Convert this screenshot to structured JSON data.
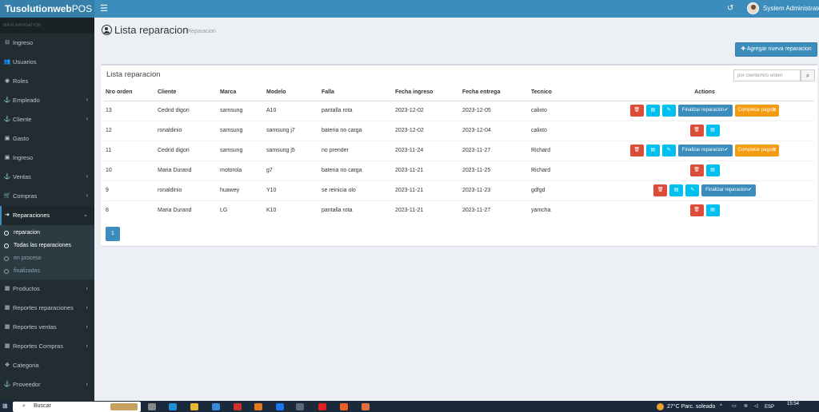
{
  "app": {
    "brand_bold": "Tusolutionweb",
    "brand_light": "POS",
    "user_name": "System Administrator"
  },
  "sidebar": {
    "header": "MAIN NAVIGATION",
    "items_top": [
      {
        "label": "Ingreso",
        "icon": "sign-in-icon",
        "glyph": "⊟",
        "chevron": false
      },
      {
        "label": "Usuarios",
        "icon": "users-icon",
        "glyph": "👥",
        "chevron": false
      },
      {
        "label": "Roles",
        "icon": "user-circle-icon",
        "glyph": "◉",
        "chevron": false
      },
      {
        "label": "Empleado",
        "icon": "anchor-icon",
        "glyph": "⚓",
        "chevron": true
      },
      {
        "label": "Cliente",
        "icon": "anchor-icon",
        "glyph": "⚓",
        "chevron": true
      },
      {
        "label": "Gasto",
        "icon": "money-icon",
        "glyph": "▣",
        "chevron": false
      },
      {
        "label": "Ingreso",
        "icon": "sign-in-icon",
        "glyph": "▣",
        "chevron": false
      },
      {
        "label": "Ventas",
        "icon": "anchor-icon",
        "glyph": "⚓",
        "chevron": true
      },
      {
        "label": "Compras",
        "icon": "cart-icon",
        "glyph": "🛒",
        "chevron": true
      }
    ],
    "active_item": {
      "label": "Reparaciones",
      "icon": "sign-in-icon",
      "glyph": "➔"
    },
    "subitems": [
      {
        "label": "reparacion",
        "on": true
      },
      {
        "label": "Todas las reparaciones",
        "on": true
      },
      {
        "label": "en proceso",
        "on": false
      },
      {
        "label": "finalizadas",
        "on": false
      }
    ],
    "items_bottom": [
      {
        "label": "Productos",
        "icon": "shop-icon",
        "glyph": "▦",
        "chevron": true
      },
      {
        "label": "Reportes reparaciones",
        "icon": "calendar-icon",
        "glyph": "▦",
        "chevron": true
      },
      {
        "label": "Reportes ventas",
        "icon": "calendar-icon",
        "glyph": "▦",
        "chevron": true
      },
      {
        "label": "Reportes Compras",
        "icon": "calendar-icon",
        "glyph": "▦",
        "chevron": true
      },
      {
        "label": "Categoria",
        "icon": "arrows-icon",
        "glyph": "✥",
        "chevron": false
      },
      {
        "label": "Proveedor",
        "icon": "anchor-icon",
        "glyph": "⚓",
        "chevron": true
      }
    ]
  },
  "page": {
    "title": "Lista reparacion",
    "subtitle": "Reparacion",
    "add_button": "✚ Agregar nueva reparacion"
  },
  "table": {
    "box_title": "Lista reparacion",
    "search_placeholder": "por cliente/Nro orden",
    "columns": [
      "Nro orden",
      "Cliente",
      "Marca",
      "Modelo",
      "Falla",
      "Fecha ingreso",
      "Fecha entrega",
      "Tecnico",
      "Actions"
    ],
    "action_labels": {
      "finalize": "Finalizar reparacion✔",
      "complete_payment": "Completar pago⊠"
    },
    "rows": [
      {
        "nro": "13",
        "cliente": "Cedrid digori",
        "marca": "samsung",
        "modelo": "A10",
        "falla": "pantalla rota",
        "ingreso": "2023-12-02",
        "entrega": "2023-12-05",
        "tecnico": "calixto",
        "actions": [
          "delete",
          "view",
          "edit",
          "finalize",
          "pay"
        ]
      },
      {
        "nro": "12",
        "cliente": "ronaldinio",
        "marca": "samsung",
        "modelo": "samsung j7",
        "falla": "bateria no carga",
        "ingreso": "2023-12-02",
        "entrega": "2023-12-04",
        "tecnico": "calixto",
        "actions": [
          "delete",
          "view"
        ]
      },
      {
        "nro": "11",
        "cliente": "Cedrid digori",
        "marca": "samsung",
        "modelo": "samsung j5",
        "falla": "no prender",
        "ingreso": "2023-11-24",
        "entrega": "2023-11-27",
        "tecnico": "Richard",
        "actions": [
          "delete",
          "view",
          "edit",
          "finalize",
          "pay"
        ]
      },
      {
        "nro": "10",
        "cliente": "Maria Durand",
        "marca": "motorola",
        "modelo": "g7",
        "falla": "bateria no carga",
        "ingreso": "2023-11-21",
        "entrega": "2023-11-25",
        "tecnico": "Richard",
        "actions": [
          "delete",
          "view"
        ]
      },
      {
        "nro": "9",
        "cliente": "ronaldinio",
        "marca": "huawey",
        "modelo": "Y10",
        "falla": "se reinicia olo",
        "ingreso": "2023-11-21",
        "entrega": "2023-11-23",
        "tecnico": "gdfgd",
        "actions": [
          "delete",
          "view",
          "edit",
          "finalize"
        ]
      },
      {
        "nro": "8",
        "cliente": "Maria Durand",
        "marca": "LG",
        "modelo": "K10",
        "falla": "pantalla rota",
        "ingreso": "2023-11-21",
        "entrega": "2023-11-27",
        "tecnico": "yamcha",
        "actions": [
          "delete",
          "view"
        ]
      }
    ],
    "current_page": "1"
  },
  "taskbar": {
    "search_label": "Buscar",
    "weather": "27°C  Parc. soleado",
    "lang": "ESP",
    "time": "15:54"
  },
  "colors": {
    "header": "#3c8dbc",
    "logo_bg": "#367fa9",
    "sidebar": "#222d32",
    "danger": "#dd4b39",
    "info": "#00c0ef",
    "primary": "#3c8dbc",
    "warning": "#f39c12"
  }
}
